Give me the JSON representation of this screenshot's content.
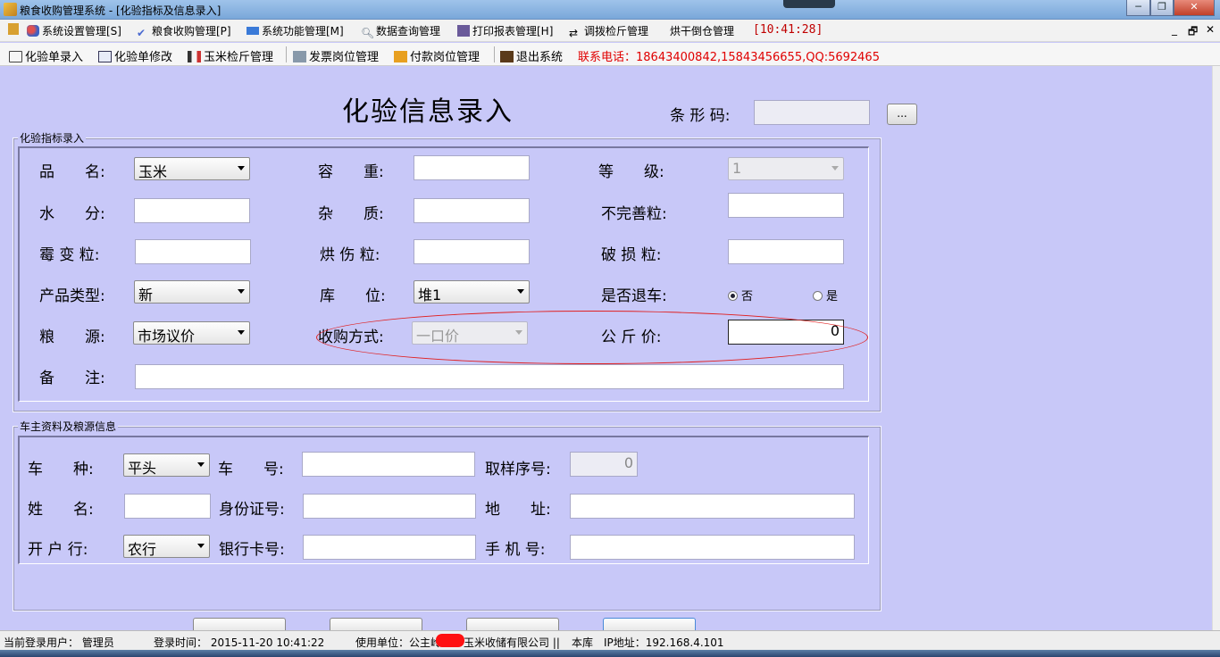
{
  "window": {
    "title": "粮食收购管理系统 - [化验指标及信息录入]",
    "min": "─",
    "max": "❐",
    "close": "✕"
  },
  "menu": {
    "items": [
      {
        "label": "系统设置管理[S]",
        "icon": "users-icon",
        "color": "#e05050"
      },
      {
        "label": "粮食收购管理[P]",
        "icon": "check-icon",
        "color": "#4a6ad0"
      },
      {
        "label": "系统功能管理[M]",
        "icon": "monitor-icon",
        "color": "#3a7ad8"
      },
      {
        "label": "数据查询管理",
        "icon": "search-icon",
        "color": "#607080"
      },
      {
        "label": "打印报表管理[H]",
        "icon": "printer-icon",
        "color": "#6a5a9a"
      },
      {
        "label": "调拨检斤管理",
        "icon": "transfer-icon",
        "color": "#404040"
      },
      {
        "label": "烘干倒仓管理",
        "icon": "",
        "color": ""
      }
    ],
    "clock": "[10:41:28]",
    "mdi_min": "_",
    "mdi_restore": "🗗",
    "mdi_close": "✕"
  },
  "toolbar": {
    "items": [
      {
        "label": "化验单录入",
        "icon": "open-folder-icon"
      },
      {
        "label": "化验单修改",
        "icon": "edit-icon"
      },
      {
        "label": "玉米检斤管理",
        "icon": "scale-icon"
      },
      {
        "label": "发票岗位管理",
        "icon": "invoice-icon"
      },
      {
        "label": "付款岗位管理",
        "icon": "payment-icon"
      },
      {
        "label": "退出系统",
        "icon": "exit-icon"
      }
    ],
    "contact": "联系电话：18643400842,15843456655,QQ:5692465"
  },
  "form": {
    "title": "化验信息录入",
    "barcode_label": "条 形 码:",
    "barcode_value": "",
    "barcode_button": "...",
    "section1": {
      "label": "化验指标录入",
      "pinming_label": "品　　名:",
      "pinming_value": "玉米",
      "rongzhong_label": "容　　重:",
      "rongzhong_value": "",
      "dengji_label": "等　　级:",
      "dengji_value": "1",
      "shuifen_label": "水　　分:",
      "shuifen_value": "",
      "zazhi_label": "杂　　质:",
      "zazhi_value": "",
      "buwanshan_label": "不完善粒:",
      "buwanshan_value": "",
      "meibian_label": "霉 变 粒:",
      "meibian_value": "",
      "hongshang_label": "烘 伤 粒:",
      "hongshang_value": "",
      "posun_label": "破 损 粒:",
      "posun_value": "",
      "chanpin_label": "产品类型:",
      "chanpin_value": "新",
      "kuwei_label": "库　　位:",
      "kuwei_value": "堆1",
      "tuiche_label": "是否退车:",
      "tuiche_no": "否",
      "tuiche_yes": "是",
      "liangyuan_label": "粮　　源:",
      "liangyuan_value": "市场议价",
      "shougou_label": "收购方式:",
      "shougou_value": "一口价",
      "gongjin_label": "公 斤 价:",
      "gongjin_value": "0",
      "beizhu_label": "备　　注:",
      "beizhu_value": ""
    },
    "section2": {
      "label": "车主资料及粮源信息",
      "chezhong_label": "车　　种:",
      "chezhong_value": "平头",
      "chehao_label": "车　　号:",
      "chehao_value": "",
      "quyang_label": "取样序号:",
      "quyang_value": "0",
      "xingming_label": "姓　　名:",
      "xingming_value": "",
      "shenfen_label": "身份证号:",
      "shenfen_value": "",
      "dizhi_label": "地　　址:",
      "dizhi_value": "",
      "kaihu_label": "开 户 行:",
      "kaihu_value": "农行",
      "yinhang_label": "银行卡号:",
      "yinhang_value": "",
      "shouji_label": "手 机 号:",
      "shouji_value": ""
    }
  },
  "status": {
    "user": "当前登录用户：  管理员",
    "login": "登录时间：  2015-11-20 10:41:22",
    "unit": "使用单位：公主岭",
    "unit_tail": "玉米收储有限公司  ||",
    "store": "本库",
    "ip": "IP地址：192.168.4.101"
  }
}
